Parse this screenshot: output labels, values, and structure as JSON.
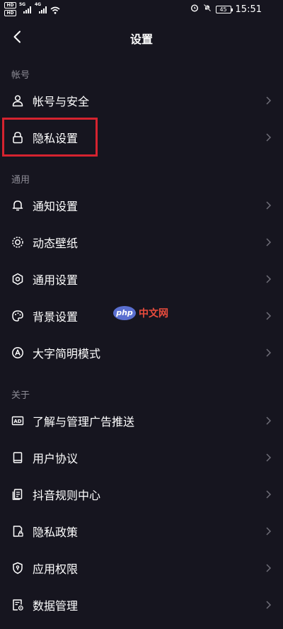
{
  "status_bar": {
    "hd1": "HD",
    "hd2": "HD",
    "sig1_tag": "5G",
    "sig2_tag": "4G",
    "battery": "45",
    "time": "15:51"
  },
  "header": {
    "title": "设置"
  },
  "sections": {
    "account": {
      "label": "帐号",
      "items": [
        {
          "label": "帐号与安全",
          "icon": "user-icon"
        },
        {
          "label": "隐私设置",
          "icon": "lock-icon"
        }
      ]
    },
    "general": {
      "label": "通用",
      "items": [
        {
          "label": "通知设置",
          "icon": "bell-icon"
        },
        {
          "label": "动态壁纸",
          "icon": "wallpaper-icon"
        },
        {
          "label": "通用设置",
          "icon": "gear-icon"
        },
        {
          "label": "背景设置",
          "icon": "palette-icon"
        },
        {
          "label": "大字简明模式",
          "icon": "font-mode-icon"
        }
      ]
    },
    "about": {
      "label": "关于",
      "items": [
        {
          "label": "了解与管理广告推送",
          "icon": "ad-icon"
        },
        {
          "label": "用户协议",
          "icon": "book-icon"
        },
        {
          "label": "抖音规则中心",
          "icon": "rules-icon"
        },
        {
          "label": "隐私政策",
          "icon": "privacy-doc-icon"
        },
        {
          "label": "应用权限",
          "icon": "shield-icon"
        },
        {
          "label": "数据管理",
          "icon": "data-manage-icon"
        }
      ]
    }
  },
  "watermark": {
    "logo": "php",
    "text": "中文网"
  },
  "colors": {
    "background": "#16151f",
    "text": "#ffffff",
    "section_label": "#8d8c96",
    "chevron": "#6f6e78",
    "highlight": "#d5232f"
  }
}
